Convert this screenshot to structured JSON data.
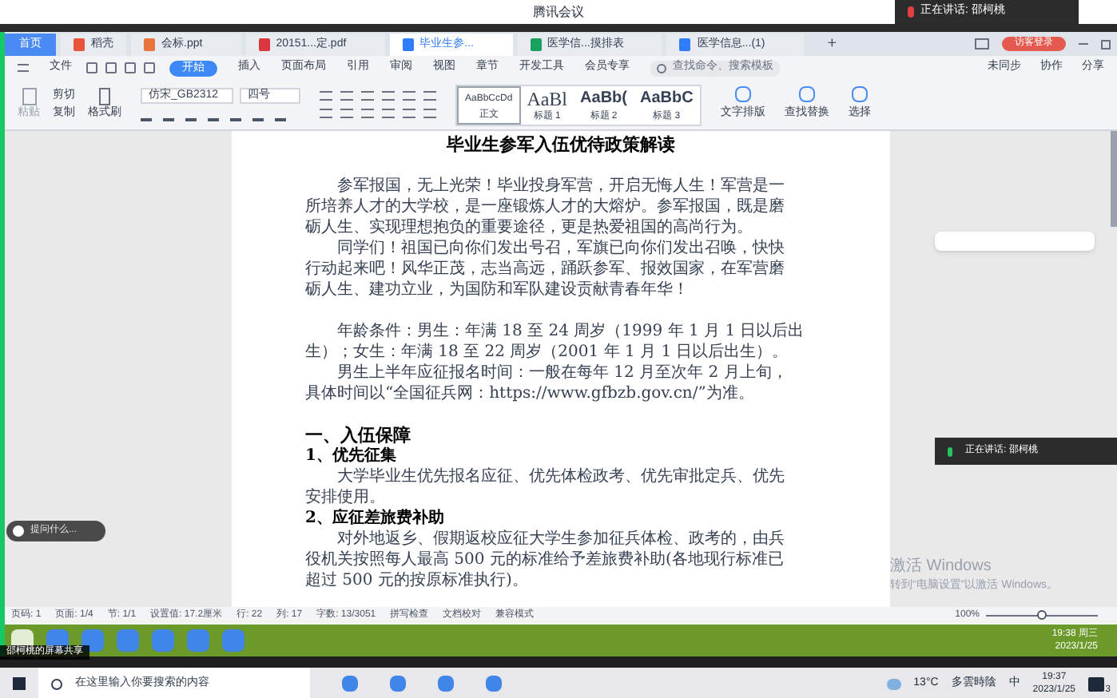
{
  "meeting": {
    "title": "腾讯会议",
    "speaking": "正在讲话: 邵柯桃",
    "speaking_panel": "正在讲话: 邵柯桃",
    "share_label": "邵柯桃的屏幕共享",
    "ask": "提问什么..."
  },
  "tabs": [
    {
      "label": "首页",
      "kind": "home",
      "selected": false
    },
    {
      "label": "稻壳",
      "kind": "docer",
      "selected": false
    },
    {
      "label": "会标.ppt",
      "kind": "ppt",
      "selected": false
    },
    {
      "label": "20151...定.pdf",
      "kind": "pdf",
      "selected": false
    },
    {
      "label": "毕业生参...",
      "kind": "doc",
      "selected": true
    },
    {
      "label": "医学信...摸排表",
      "kind": "xls",
      "selected": false
    },
    {
      "label": "医学信息...(1)",
      "kind": "doc",
      "selected": false
    }
  ],
  "new_tab": "+",
  "login_button": "访客登录",
  "menu": [
    {
      "label": "文件",
      "selected": false
    },
    {
      "label": "开始",
      "selected": true
    },
    {
      "label": "插入",
      "selected": false
    },
    {
      "label": "页面布局",
      "selected": false
    },
    {
      "label": "引用",
      "selected": false
    },
    {
      "label": "审阅",
      "selected": false
    },
    {
      "label": "视图",
      "selected": false
    },
    {
      "label": "章节",
      "selected": false
    },
    {
      "label": "开发工具",
      "selected": false
    },
    {
      "label": "会员专享",
      "selected": false
    }
  ],
  "command_search": {
    "placeholder": "查找命令、搜索模板"
  },
  "cloud_actions": [
    "未同步",
    "协作",
    "分享"
  ],
  "ribbon": {
    "clipboard": [
      "粘贴",
      "剪切",
      "复制",
      "格式刷"
    ],
    "font_name": "仿宋_GB2312",
    "font_size": "四号",
    "styles": [
      {
        "preview": "AaBbCcDd",
        "label": "正文",
        "selected": true
      },
      {
        "preview": "AaBl",
        "label": "标题 1",
        "selected": false
      },
      {
        "preview": "AaBb(",
        "label": "标题 2",
        "selected": false
      },
      {
        "preview": "AaBbC",
        "label": "标题 3",
        "selected": false
      }
    ],
    "actions": [
      "文字排版",
      "查找替换",
      "选择"
    ]
  },
  "document": {
    "title": "毕业生参军入伍优待政策解读",
    "blocks": [
      {
        "kind": "para",
        "lines": [
          "参军报国，无上光荣！毕业投身军营，开启无悔人生！军营是一",
          "所培养人才的大学校，是一座锻炼人才的大熔炉。参军报国，既是磨",
          "砺人生、实现理想抱负的重要途径，更是热爱祖国的高尚行为。"
        ]
      },
      {
        "kind": "para",
        "lines": [
          "同学们！祖国已向你们发出号召，军旗已向你们发出召唤，快快",
          "行动起来吧！风华正茂，志当高远，踊跃参军、报效国家，在军营磨",
          "砺人生、建功立业，为国防和军队建设贡献青春年华！"
        ]
      },
      {
        "kind": "blank"
      },
      {
        "kind": "para",
        "lines": [
          "年龄条件：男生：年满 18 至 24 周岁（1999 年 1 月 1 日以后出",
          "生）；女生：年满 18 至 22 周岁（2001 年 1 月 1 日以后出生）。"
        ]
      },
      {
        "kind": "para",
        "lines": [
          "男生上半年应征报名时间：一般在每年 12 月至次年 2 月上旬，",
          "具体时间以“全国征兵网：https://www.gfbzb.gov.cn/”为准。"
        ]
      },
      {
        "kind": "blank"
      },
      {
        "kind": "heading",
        "lines": [
          "一、入伍保障"
        ]
      },
      {
        "kind": "subheading",
        "lines": [
          "1、优先征集"
        ]
      },
      {
        "kind": "para",
        "lines": [
          "大学毕业生优先报名应征、优先体检政考、优先审批定兵、优先",
          "安排使用。"
        ]
      },
      {
        "kind": "subheading",
        "lines": [
          "2、应征差旅费补助"
        ]
      },
      {
        "kind": "para",
        "lines": [
          "对外地返乡、假期返校应征大学生参加征兵体检、政考的，由兵",
          "役机关按照每人最高 500 元的标准给予差旅费补助(各地现行标准已",
          "超过 500 元的按原标准执行)。"
        ]
      }
    ]
  },
  "status_bar": [
    "页码: 1",
    "页面: 1/4",
    "节: 1/1",
    "设置值: 17.2厘米",
    "行: 22",
    "列: 17",
    "字数: 13/3051",
    "拼写检查",
    "文档校对",
    "兼容模式"
  ],
  "zoom": {
    "reading": "100%",
    "level": 0.5
  },
  "activation": [
    "激活 Windows",
    "转到“电脑设置”以激活 Windows。"
  ],
  "remote_clock": {
    "time": "19:38 周三",
    "date": "2023/1/25"
  },
  "taskbar": {
    "search": {
      "placeholder": "在这里输入你要搜索的内容"
    },
    "weather": "13°C",
    "weather_text": "多雲時陰",
    "ime": "中",
    "time": "19:37",
    "date": "2023/1/25",
    "notifications": "3"
  }
}
